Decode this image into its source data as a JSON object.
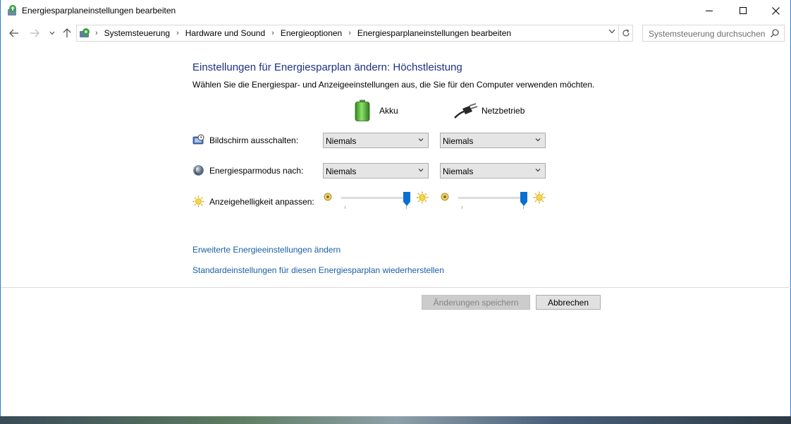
{
  "window": {
    "title": "Energiesparplaneinstellungen bearbeiten"
  },
  "nav": {
    "breadcrumb": [
      "Systemsteuerung",
      "Hardware und Sound",
      "Energieoptionen",
      "Energiesparplaneinstellungen bearbeiten"
    ],
    "search_placeholder": "Systemsteuerung durchsuchen"
  },
  "content": {
    "heading": "Einstellungen für Energiesparplan ändern: Höchstleistung",
    "subtext": "Wählen Sie die Energiespar- und Anzeigeeinstellungen aus, die Sie für den Computer verwenden möchten.",
    "columns": {
      "battery": "Akku",
      "plugged": "Netzbetrieb"
    },
    "settings": [
      {
        "label": "Bildschirm ausschalten:",
        "battery": "Niemals",
        "plugged": "Niemals"
      },
      {
        "label": "Energiesparmodus nach:",
        "battery": "Niemals",
        "plugged": "Niemals"
      }
    ],
    "brightness": {
      "label": "Anzeigehelligkeit anpassen:",
      "battery_level": 0.97,
      "plugged_level": 0.97
    },
    "links": {
      "advanced": "Erweiterte Energieeinstellungen ändern",
      "restore": "Standardeinstellungen für diesen Energiesparplan wiederherstellen"
    }
  },
  "buttons": {
    "save": "Änderungen speichern",
    "cancel": "Abbrechen"
  },
  "colors": {
    "heading": "#1e3287",
    "link": "#1b5fa8",
    "slider_thumb": "#0a6fd1"
  },
  "icons": {
    "title": "power-options-icon",
    "battery": "battery-icon",
    "plug": "power-plug-icon",
    "display_timer": "display-timer-icon",
    "sleep": "sleep-moon-icon",
    "brightness": "sun-icon"
  }
}
